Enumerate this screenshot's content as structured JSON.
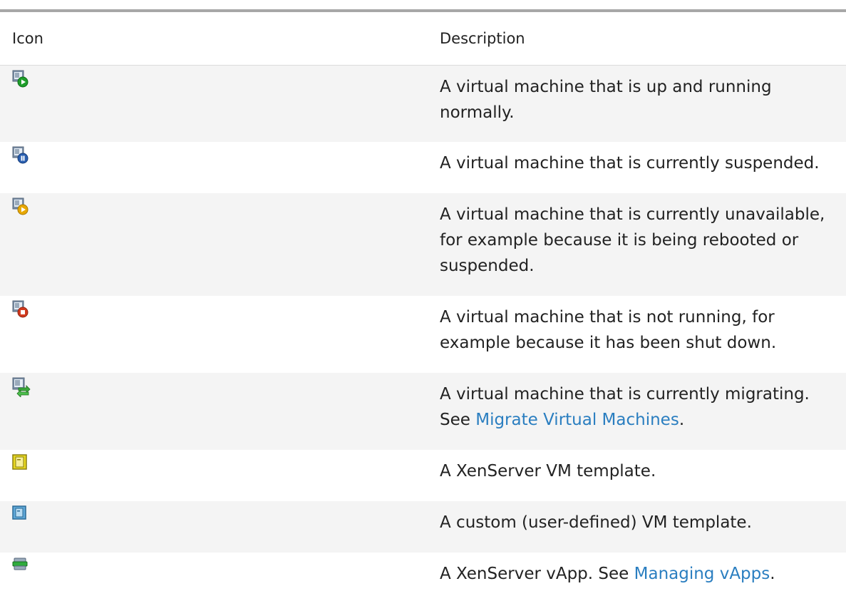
{
  "table": {
    "headers": {
      "icon": "Icon",
      "description": "Description"
    },
    "rows": [
      {
        "icon": "vm-running-icon",
        "description": "A virtual machine that is up and running normally."
      },
      {
        "icon": "vm-suspended-icon",
        "description": "A virtual machine that is currently suspended."
      },
      {
        "icon": "vm-unavailable-icon",
        "description": "A virtual machine that is currently unavailable, for example because it is being rebooted or suspended."
      },
      {
        "icon": "vm-stopped-icon",
        "description": "A virtual machine that is not running, for example because it has been shut down."
      },
      {
        "icon": "vm-migrating-icon",
        "description": "A virtual machine that is currently migrating.",
        "see": "See",
        "link": "Migrate Virtual Machines",
        "after": "."
      },
      {
        "icon": "xenserver-template-icon",
        "description": "A XenServer VM template."
      },
      {
        "icon": "custom-template-icon",
        "description": "A custom (user-defined) VM template."
      },
      {
        "icon": "vapp-icon",
        "description": "A XenServer vApp.  See",
        "link": "Managing vApps",
        "after": "."
      }
    ]
  },
  "colors": {
    "link": "#2a7ec0",
    "running": "#1e9e2a",
    "suspended": "#2a5fb0",
    "unavailable": "#e8a800",
    "stopped": "#d23a1e",
    "migrating": "#3aa83a",
    "template": "#e8d820",
    "custom_template": "#5fa8d8"
  }
}
